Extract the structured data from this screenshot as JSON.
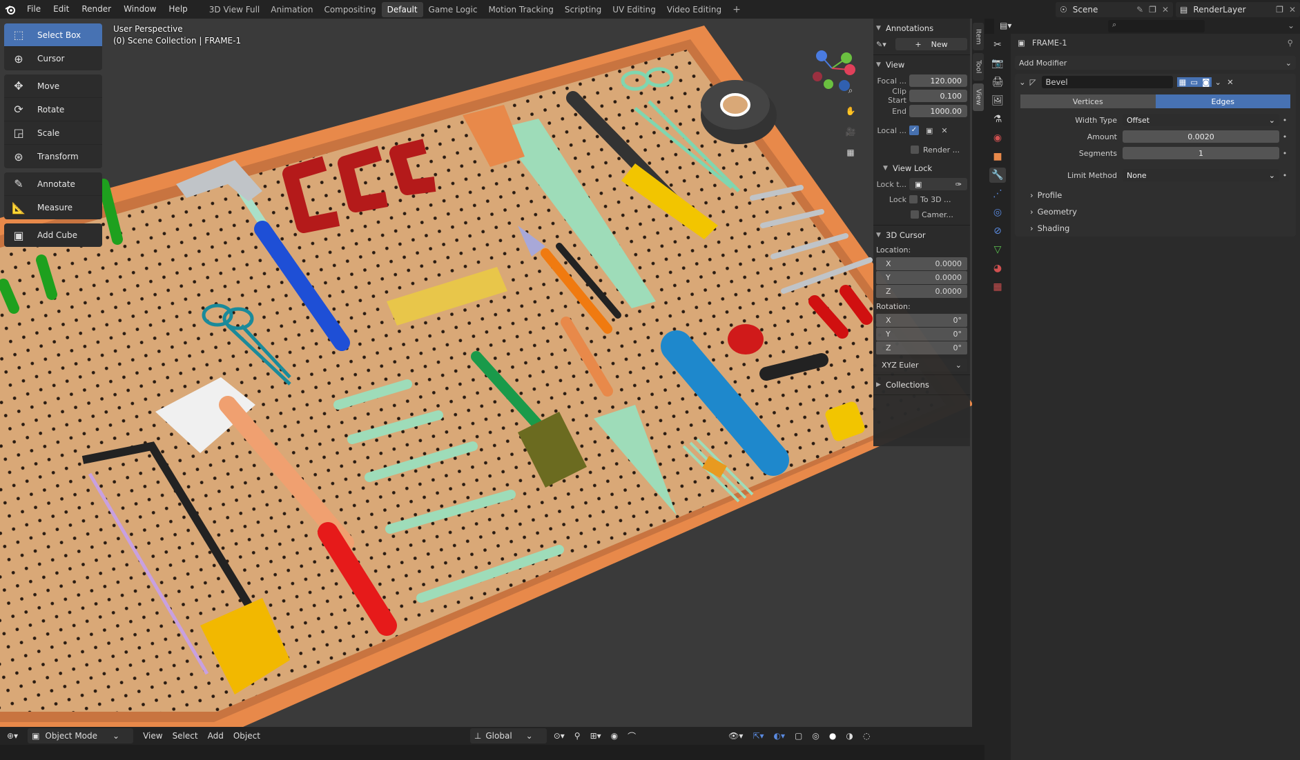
{
  "topbar": {
    "menu": [
      "File",
      "Edit",
      "Render",
      "Window",
      "Help"
    ],
    "workspaces": [
      "3D View Full",
      "Animation",
      "Compositing",
      "Default",
      "Game Logic",
      "Motion Tracking",
      "Scripting",
      "UV Editing",
      "Video Editing"
    ],
    "active_workspace": "Default",
    "scene": "Scene",
    "render_layer": "RenderLayer"
  },
  "toolshelf": {
    "group1": [
      "Select Box",
      "Cursor"
    ],
    "group2": [
      "Move",
      "Rotate",
      "Scale",
      "Transform"
    ],
    "group3": [
      "Annotate",
      "Measure"
    ],
    "group4": [
      "Add Cube"
    ]
  },
  "viewport": {
    "perspective": "User Perspective",
    "collection": "(0) Scene Collection | FRAME-1"
  },
  "npanel": {
    "annotations": {
      "title": "Annotations",
      "new_label": "New"
    },
    "view": {
      "title": "View",
      "focal_label": "Focal ...",
      "focal": "120.000",
      "clip_start_label": "Clip Start",
      "clip_start": "0.100",
      "end_label": "End",
      "end": "1000.00",
      "local_label": "Local ...",
      "render_label": "Render ..."
    },
    "view_lock": {
      "title": "View Lock",
      "lock_to_label": "Lock t...",
      "lock_label": "Lock",
      "to_3d": "To 3D ...",
      "camera": "Camer..."
    },
    "cursor": {
      "title": "3D Cursor",
      "location_label": "Location:",
      "loc_x": "0.0000",
      "loc_y": "0.0000",
      "loc_z": "0.0000",
      "rotation_label": "Rotation:",
      "rot_x": "0°",
      "rot_y": "0°",
      "rot_z": "0°",
      "mode": "XYZ Euler",
      "x": "X",
      "y": "Y",
      "z": "Z"
    },
    "collections": {
      "title": "Collections"
    }
  },
  "sidetabs": [
    "Item",
    "Tool",
    "View"
  ],
  "properties": {
    "object_name": "FRAME-1",
    "add_modifier": "Add Modifier",
    "modifier_name": "Bevel",
    "seg_vertices": "Vertices",
    "seg_edges": "Edges",
    "width_type_label": "Width Type",
    "width_type": "Offset",
    "amount_label": "Amount",
    "amount": "0.0020",
    "segments_label": "Segments",
    "segments": "1",
    "limit_method_label": "Limit Method",
    "limit_method": "None",
    "subpanels": [
      "Profile",
      "Geometry",
      "Shading"
    ]
  },
  "bottombar": {
    "mode": "Object Mode",
    "menus": [
      "View",
      "Select",
      "Add",
      "Object"
    ],
    "transform_orientation": "Global"
  },
  "colors": {
    "accent": "#4772b3",
    "board": "#d9a877",
    "frame": "#e8894a"
  }
}
